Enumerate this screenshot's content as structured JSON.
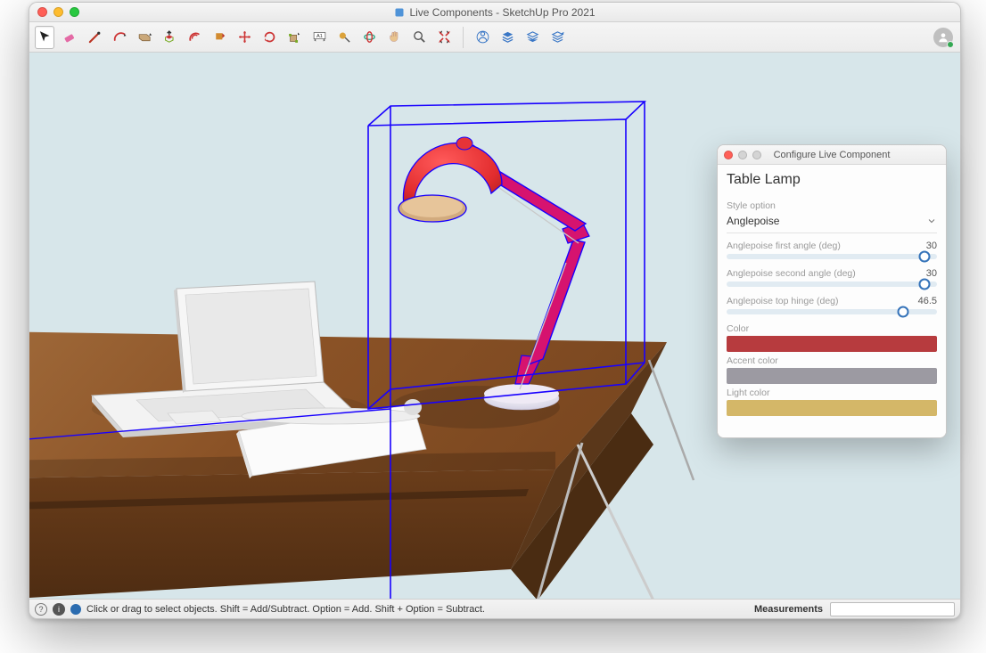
{
  "window": {
    "title": "Live Components - SketchUp Pro 2021"
  },
  "toolbar": {
    "tools": [
      {
        "name": "select-tool",
        "selected": true
      },
      {
        "name": "eraser-tool"
      },
      {
        "name": "line-tool"
      },
      {
        "name": "arc-tool"
      },
      {
        "name": "rectangle-tool"
      },
      {
        "name": "pushpull-tool"
      },
      {
        "name": "offset-tool"
      },
      {
        "name": "paint-bucket-tool"
      },
      {
        "name": "move-tool"
      },
      {
        "name": "rotate-tool"
      },
      {
        "name": "scale-tool"
      },
      {
        "name": "dimension-tool"
      },
      {
        "name": "tape-measure-tool"
      },
      {
        "name": "orbit-tool"
      },
      {
        "name": "pan-tool"
      },
      {
        "name": "zoom-tool"
      },
      {
        "name": "zoom-extents-tool"
      }
    ]
  },
  "status": {
    "hint": "Click or drag to select objects. Shift = Add/Subtract. Option = Add. Shift + Option = Subtract.",
    "measurements_label": "Measurements",
    "measurements_value": ""
  },
  "panel": {
    "title": "Configure Live Component",
    "heading": "Table Lamp",
    "style_label": "Style option",
    "style_value": "Anglepoise",
    "sliders": [
      {
        "label": "Anglepoise first angle (deg)",
        "value": "30",
        "pos": 0.94
      },
      {
        "label": "Anglepoise second angle (deg)",
        "value": "30",
        "pos": 0.94
      },
      {
        "label": "Anglepoise top hinge (deg)",
        "value": "46.5",
        "pos": 0.84
      }
    ],
    "colors": [
      {
        "label": "Color",
        "hex": "#b73b3e"
      },
      {
        "label": "Accent color",
        "hex": "#9c9aa2"
      },
      {
        "label": "Light color",
        "hex": "#d4b768"
      }
    ]
  }
}
